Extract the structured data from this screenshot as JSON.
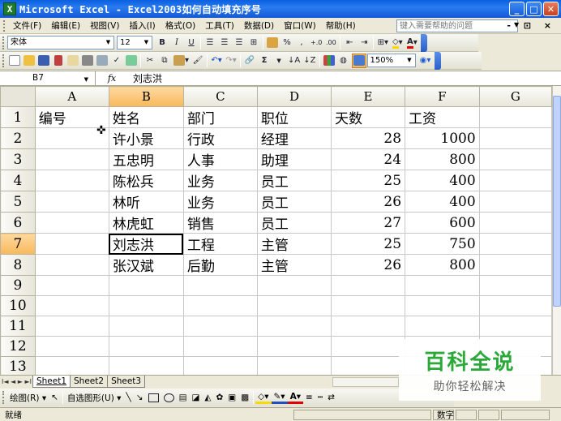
{
  "window": {
    "app_icon": "X",
    "title": "Microsoft Excel - Excel2003如何自动填充序号",
    "buttons": [
      "_",
      "□",
      "✕"
    ]
  },
  "menubar": {
    "items": [
      "文件(F)",
      "编辑(E)",
      "视图(V)",
      "插入(I)",
      "格式(O)",
      "工具(T)",
      "数据(D)",
      "窗口(W)",
      "帮助(H)"
    ],
    "help_placeholder": "键入需要帮助的问题",
    "doc_controls": "- ⊡ ×"
  },
  "format_toolbar": {
    "font": "宋体",
    "size": "12",
    "bold": "B",
    "italic": "I",
    "underline": "U",
    "percent": "%",
    "comma": ",",
    "inc_decimal": "+.0",
    "dec_decimal": ".00"
  },
  "standard_toolbar": {
    "sum": "Σ",
    "zoom": "150%"
  },
  "formula_bar": {
    "name_box": "B7",
    "fx": "fx",
    "content": "刘志洪"
  },
  "grid": {
    "columns": [
      "A",
      "B",
      "C",
      "D",
      "E",
      "F",
      "G"
    ],
    "selected_column": "B",
    "selected_row": "7",
    "rows": [
      {
        "num": "1",
        "cells": [
          "编号",
          "姓名",
          "部门",
          "职位",
          "天数",
          "工资",
          ""
        ]
      },
      {
        "num": "2",
        "cells": [
          "",
          "许小景",
          "行政",
          "经理",
          "28",
          "1000",
          ""
        ]
      },
      {
        "num": "3",
        "cells": [
          "",
          "五忠明",
          "人事",
          "助理",
          "24",
          "800",
          ""
        ]
      },
      {
        "num": "4",
        "cells": [
          "",
          "陈松兵",
          "业务",
          "员工",
          "25",
          "400",
          ""
        ]
      },
      {
        "num": "5",
        "cells": [
          "",
          "林听",
          "业务",
          "员工",
          "26",
          "400",
          ""
        ]
      },
      {
        "num": "6",
        "cells": [
          "",
          "林虎虹",
          "销售",
          "员工",
          "27",
          "600",
          ""
        ]
      },
      {
        "num": "7",
        "cells": [
          "",
          "刘志洪",
          "工程",
          "主管",
          "25",
          "750",
          ""
        ]
      },
      {
        "num": "8",
        "cells": [
          "",
          "张汉斌",
          "后勤",
          "主管",
          "26",
          "800",
          ""
        ]
      },
      {
        "num": "9",
        "cells": [
          "",
          "",
          "",
          "",
          "",
          "",
          ""
        ]
      },
      {
        "num": "10",
        "cells": [
          "",
          "",
          "",
          "",
          "",
          "",
          ""
        ]
      },
      {
        "num": "11",
        "cells": [
          "",
          "",
          "",
          "",
          "",
          "",
          ""
        ]
      },
      {
        "num": "12",
        "cells": [
          "",
          "",
          "",
          "",
          "",
          "",
          ""
        ]
      },
      {
        "num": "13",
        "cells": [
          "",
          "",
          "",
          "",
          "",
          "",
          ""
        ]
      }
    ]
  },
  "sheet_tabs": {
    "nav": "I◄ ◄ ► ►I",
    "tabs": [
      "Sheet1",
      "Sheet2",
      "Sheet3"
    ],
    "active": "Sheet1"
  },
  "drawing_toolbar": {
    "draw": "绘图(R) ▾",
    "autoshapes": "自选图形(U) ▾"
  },
  "statusbar": {
    "ready": "就绪",
    "num": "数字"
  },
  "watermark": {
    "title": "百科全说",
    "subtitle": "助你轻松解决"
  }
}
